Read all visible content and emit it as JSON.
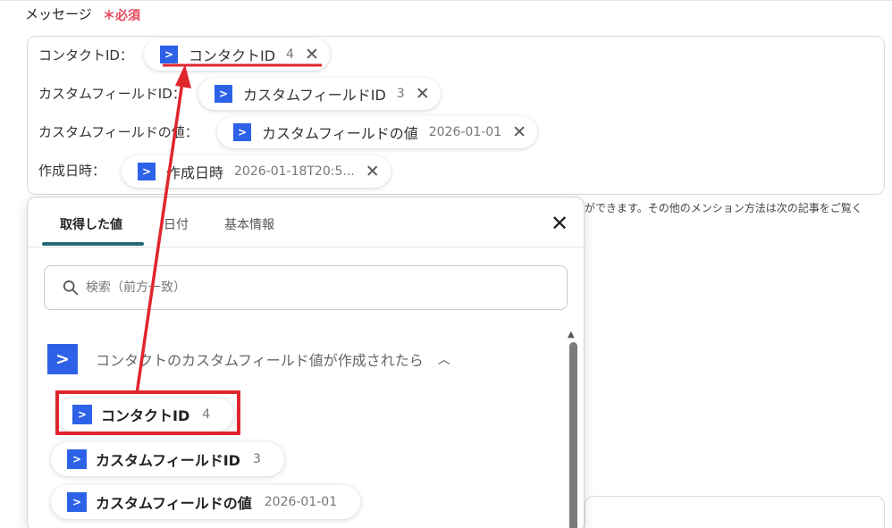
{
  "field": {
    "label": "メッセージ",
    "required": "＊必須"
  },
  "message_rows": [
    {
      "label": "コンタクトID：",
      "chip": {
        "name": "コンタクトID",
        "value": "4"
      }
    },
    {
      "label": "カスタムフィールドID：",
      "chip": {
        "name": "カスタムフィールドID",
        "value": "3"
      }
    },
    {
      "label": "カスタムフィールドの値：",
      "chip": {
        "name": "カスタムフィールドの値",
        "value": "2026-01-01"
      }
    },
    {
      "label": "作成日時：",
      "chip": {
        "name": "作成日時",
        "value": "2026-01-18T20:5..."
      }
    }
  ],
  "hint": "ができます。その他のメンション方法は次の記事をご覧く",
  "panel": {
    "tabs": [
      "取得した値",
      "日付",
      "基本情報"
    ],
    "active_tab": "取得した値",
    "search_placeholder": "検索（前方一致）",
    "trigger_title": "コンタクトのカスタムフィールド値が作成されたら",
    "items": [
      {
        "name": "コンタクトID",
        "value": "4"
      },
      {
        "name": "カスタムフィールドID",
        "value": "3"
      },
      {
        "name": "カスタムフィールドの値",
        "value": "2026-01-01"
      }
    ]
  },
  "icons": {
    "app": "chevron-right-app-icon",
    "remove": "close-icon",
    "close": "close-icon",
    "search": "search-icon",
    "collapse": "chevron-up-icon"
  },
  "colors": {
    "app_icon": "#2d62e8",
    "required": "#e8475a",
    "active_tab_underline": "#236a78",
    "annotation": "#e0262d"
  }
}
